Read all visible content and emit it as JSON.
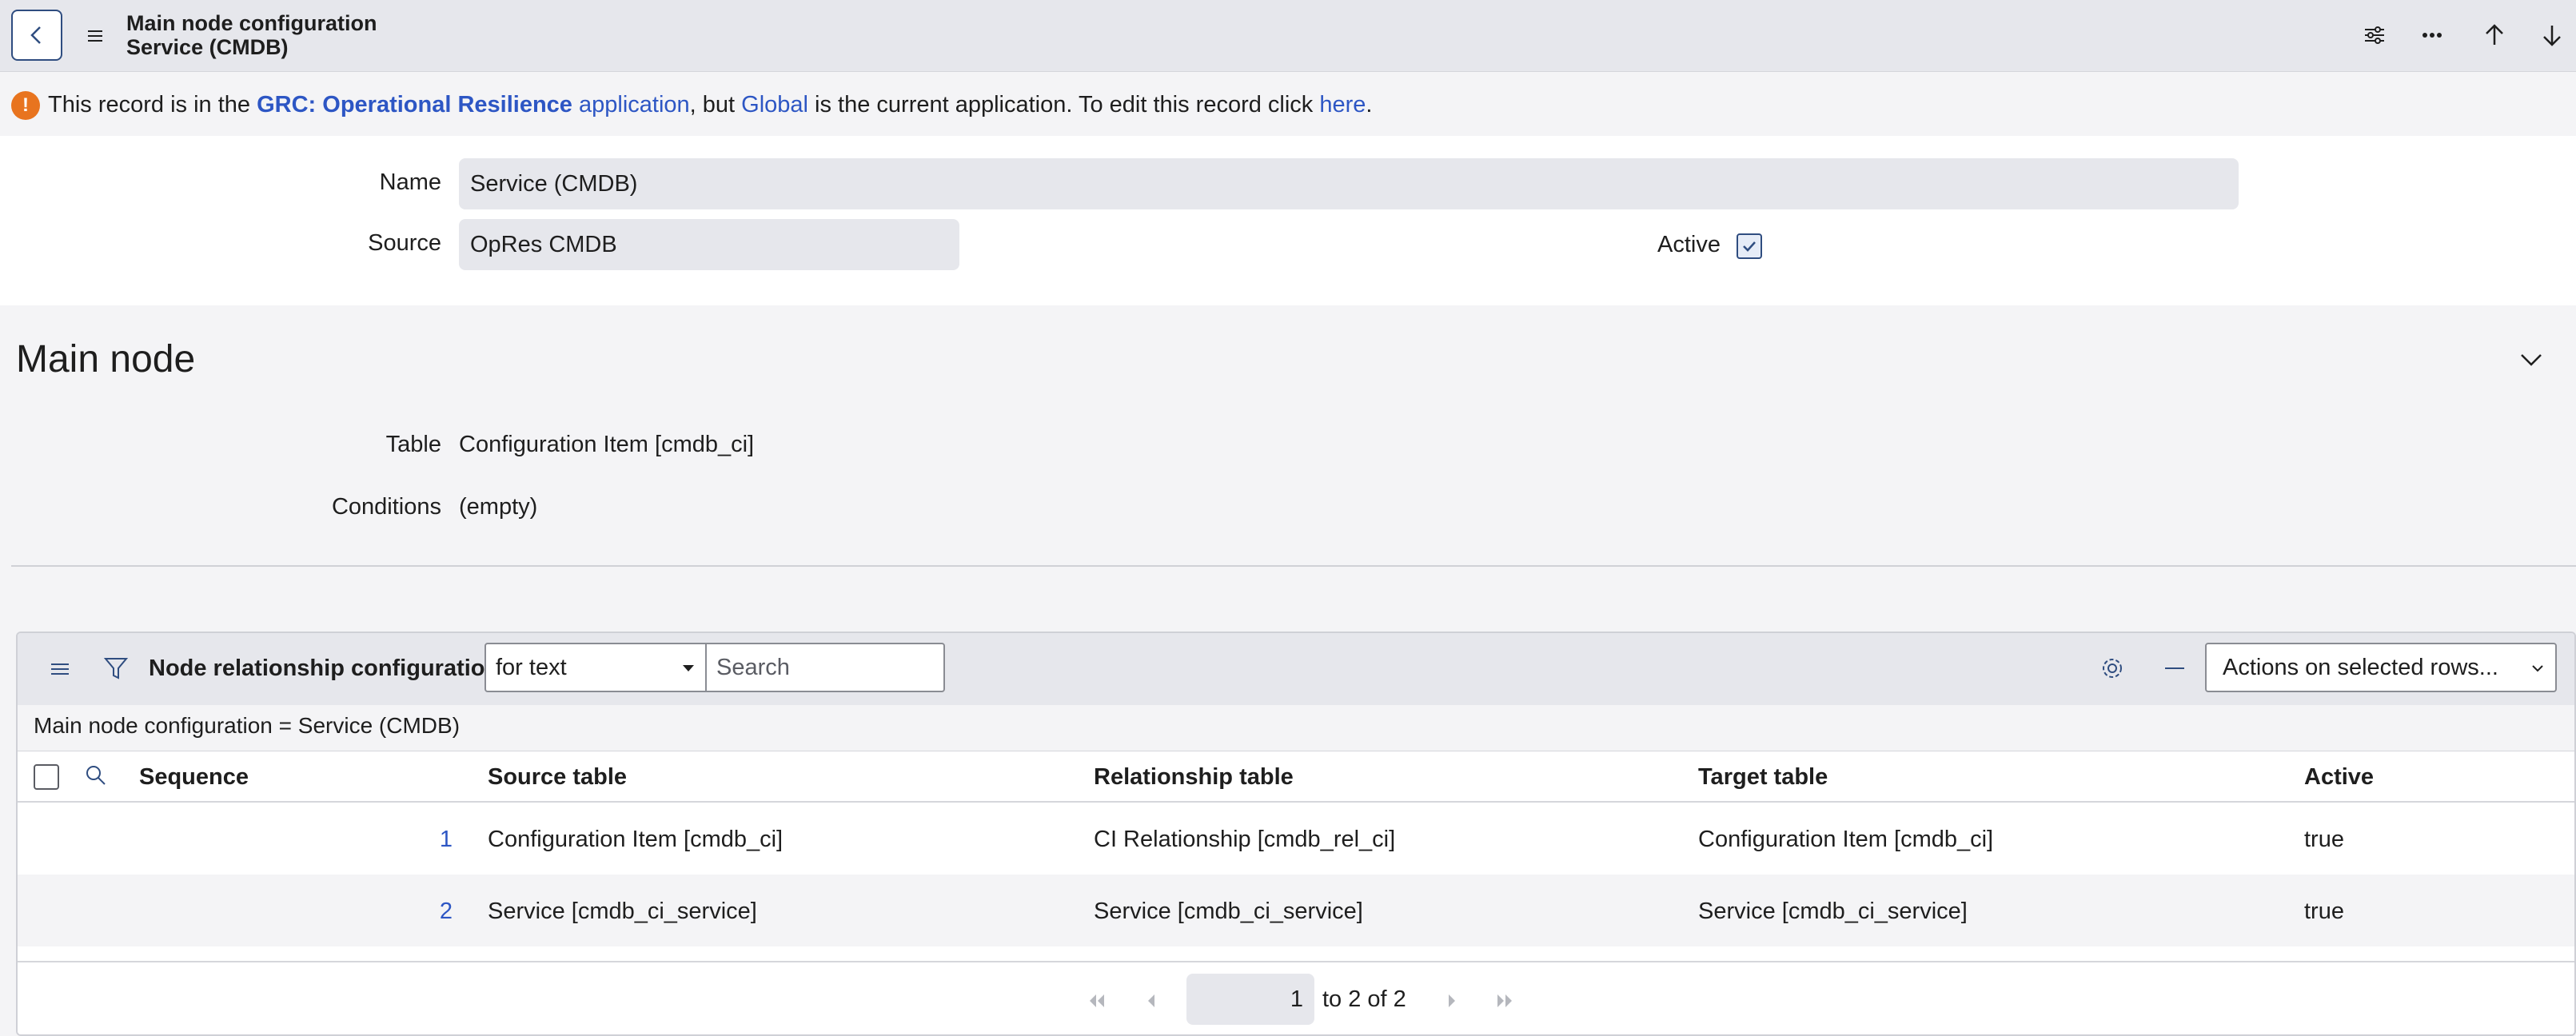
{
  "header": {
    "title_line1": "Main node configuration",
    "title_line2": "Service (CMDB)"
  },
  "banner": {
    "prefix": "This record is in the ",
    "app_name": "GRC: Operational Resilience",
    "app_word": " application",
    "middle": ", but ",
    "current_app": "Global",
    "suffix": " is the current application. To edit this record click ",
    "here": "here",
    "end": "."
  },
  "form": {
    "name_label": "Name",
    "name_value": "Service (CMDB)",
    "source_label": "Source",
    "source_value": "OpRes CMDB",
    "active_label": "Active",
    "active_checked": true
  },
  "main_node": {
    "title": "Main node",
    "table_label": "Table",
    "table_value": "Configuration Item [cmdb_ci]",
    "conditions_label": "Conditions",
    "conditions_value": "(empty)"
  },
  "related_list": {
    "title": "Node relationship configurations",
    "search_field": "for text",
    "search_placeholder": "Search",
    "actions_label": "Actions on selected rows...",
    "filter_text": "Main node configuration = Service (CMDB)",
    "columns": [
      "Sequence",
      "Source table",
      "Relationship table",
      "Target table",
      "Active"
    ],
    "rows": [
      {
        "sequence": "1",
        "source": "Configuration Item [cmdb_ci]",
        "relationship": "CI Relationship [cmdb_rel_ci]",
        "target": "Configuration Item [cmdb_ci]",
        "active": "true"
      },
      {
        "sequence": "2",
        "source": "Service [cmdb_ci_service]",
        "relationship": "Service [cmdb_ci_service]",
        "target": "Service [cmdb_ci_service]",
        "active": "true"
      }
    ],
    "pager": {
      "current": "1",
      "text": "to 2 of 2"
    }
  },
  "colors": {
    "accent": "#2f4d80",
    "link": "#2d56c4",
    "warning": "#e8741f"
  }
}
